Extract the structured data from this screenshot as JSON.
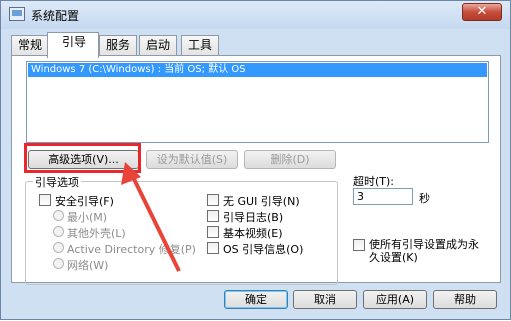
{
  "window": {
    "title": "系统配置",
    "close_label": "✕"
  },
  "tabs": [
    "常规",
    "引导",
    "服务",
    "启动",
    "工具"
  ],
  "active_tab": "引导",
  "os_list": {
    "items": [
      "Windows 7 (C:\\Windows) : 当前 OS; 默认 OS"
    ],
    "selected_index": 0
  },
  "boot_buttons": {
    "advanced": "高级选项(V)...",
    "set_default": "设为默认值(S)",
    "delete": "删除(D)"
  },
  "boot_options": {
    "group_label": "引导选项",
    "safe_boot": "安全引导(F)",
    "minimal": "最小(M)",
    "alternate_shell": "其他外壳(L)",
    "active_directory_repair": "Active Directory 修复(P)",
    "network": "网络(W)",
    "no_gui_boot": "无 GUI 引导(N)",
    "boot_log": "引导日志(B)",
    "base_video": "基本视频(E)",
    "os_boot_info": "OS 引导信息(O)"
  },
  "timeout": {
    "label": "超时(T):",
    "value": "3",
    "unit": "秒"
  },
  "make_permanent": "使所有引导设置成为永久设置(K)",
  "dialog_buttons": {
    "ok": "确定",
    "cancel": "取消",
    "apply": "应用(A)",
    "help": "帮助"
  },
  "colors": {
    "highlight_box": "#e8282b",
    "selection": "#3399ff",
    "close_button": "#c74d3c"
  }
}
